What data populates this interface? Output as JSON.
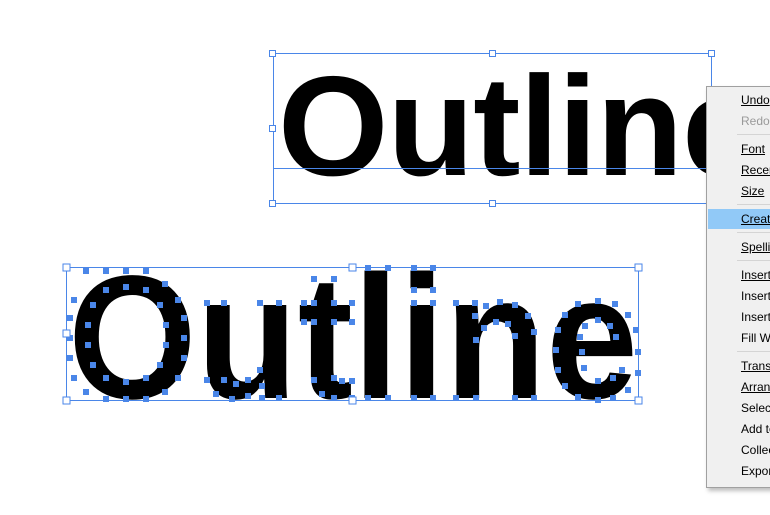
{
  "canvas": {
    "top_text": "Outline",
    "outlined_text": "Outline"
  },
  "colors": {
    "selection": "#4a86e8",
    "anchor_point": "#4a86e8",
    "menu_background": "#f0f0f0",
    "menu_highlight": "#91c9f7",
    "menu_disabled_text": "#9a9a9a"
  },
  "context_menu": {
    "items": [
      {
        "label": "Undo",
        "disabled": false,
        "highlighted": false
      },
      {
        "label": "Redo",
        "disabled": true,
        "highlighted": false
      },
      {
        "label": "Font",
        "disabled": false,
        "highlighted": false
      },
      {
        "label": "Recen",
        "disabled": false,
        "highlighted": false
      },
      {
        "label": "Size",
        "disabled": false,
        "highlighted": false
      },
      {
        "label": "Create",
        "disabled": false,
        "highlighted": true
      },
      {
        "label": "Spellir",
        "disabled": false,
        "highlighted": false
      },
      {
        "label": "Insert",
        "disabled": false,
        "highlighted": false
      },
      {
        "label": "Insert",
        "disabled": false,
        "highlighted": false
      },
      {
        "label": "Insert",
        "disabled": false,
        "highlighted": false
      },
      {
        "label": "Fill Wi",
        "disabled": false,
        "highlighted": false
      },
      {
        "label": "Transf",
        "disabled": false,
        "highlighted": false
      },
      {
        "label": "Arrang",
        "disabled": false,
        "highlighted": false
      },
      {
        "label": "Select",
        "disabled": false,
        "highlighted": false
      },
      {
        "label": "Add to",
        "disabled": false,
        "highlighted": false
      },
      {
        "label": "Collec",
        "disabled": false,
        "highlighted": false
      },
      {
        "label": "Expor",
        "disabled": false,
        "highlighted": false
      }
    ]
  }
}
